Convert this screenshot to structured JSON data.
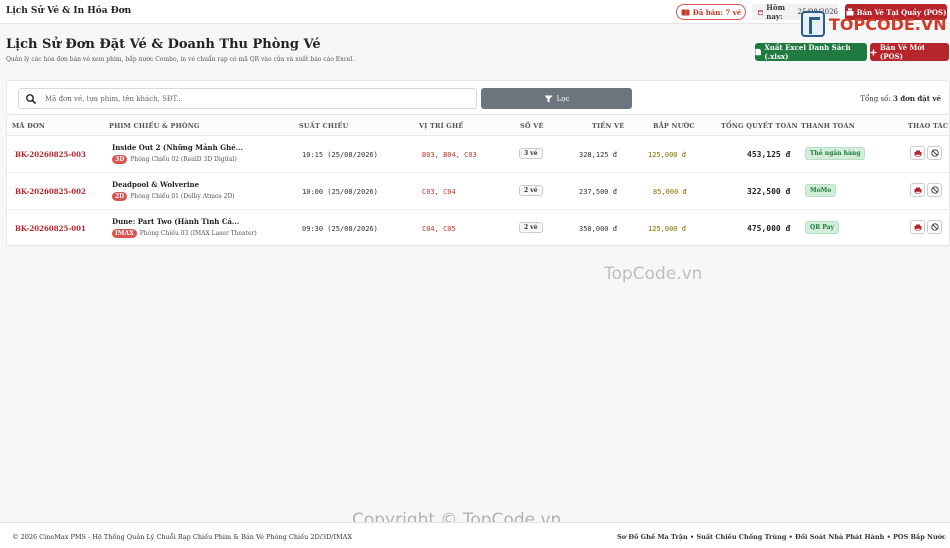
{
  "header": {
    "app_title": "Lịch Sử Vé & In Hóa Đơn",
    "sold_label": "Đã bán: 7 vé",
    "today_label": "Hôm nay:",
    "today_value": "25/08/2026",
    "pos_button": "Bán Vé Tại Quầy (POS)"
  },
  "logo": {
    "text": "TOPCODE.VN"
  },
  "page": {
    "title": "Lịch Sử Đơn Đặt Vé & Doanh Thu Phòng Vé",
    "subtitle": "Quản lý các hóa đơn bán vé xem phim, bắp nước Combo, in vé chuẩn rạp có mã QR vào cửa và xuất báo cáo Excel.",
    "export_button": "Xuất Excel Danh Sách (.xlsx)",
    "new_button": "Bán Vé Mới (POS)"
  },
  "filters": {
    "search_placeholder": "Mã đơn vé, tựa phim, tên khách, SĐT...",
    "filter_button": "Lọc",
    "total_prefix": "Tổng số:",
    "total_value": "3 đơn đặt vé"
  },
  "table": {
    "headers": [
      "MÃ ĐƠN",
      "PHIM CHIẾU & PHÒNG",
      "SUẤT CHIẾU",
      "VỊ TRÍ GHẾ",
      "SỐ VÉ",
      "TIỀN VÉ",
      "BẮP NƯỚC",
      "TỔNG QUYẾT TOÁN",
      "THANH TOÁN",
      "THAO TÁC"
    ],
    "rows": [
      {
        "code": "BK-20260825-003",
        "movie": "Inside Out 2 (Những Mảnh Ghé...",
        "format": "3D",
        "room": "Phòng Chiếu 02 (RealD 3D Digital)",
        "showtime": "10:15 (25/08/2026)",
        "seats": "B03, B04, C03",
        "qty": "3 vé",
        "ticket": "328,125 đ",
        "snack": "125,000 đ",
        "grand": "453,125 đ",
        "payment": "Thẻ ngân hàng"
      },
      {
        "code": "BK-20260825-002",
        "movie": "Deadpool & Wolverine",
        "format": "2D",
        "room": "Phòng Chiếu 01 (Dolby Atmos 2D)",
        "showtime": "10:00 (25/08/2026)",
        "seats": "C03, C04",
        "qty": "2 vé",
        "ticket": "237,500 đ",
        "snack": "85,000 đ",
        "grand": "322,500 đ",
        "payment": "MoMo"
      },
      {
        "code": "BK-20260825-001",
        "movie": "Dune: Part Two (Hành Tinh Cá...",
        "format": "IMAX",
        "room": "Phòng Chiếu 03 (IMAX Laser Theater)",
        "showtime": "09:30 (25/08/2026)",
        "seats": "C04, C05",
        "qty": "2 vé",
        "ticket": "350,000 đ",
        "snack": "125,000 đ",
        "grand": "475,000 đ",
        "payment": "QR Pay"
      }
    ]
  },
  "footer": {
    "left": "© 2026 CineMax PMS - Hệ Thống Quản Lý Chuỗi Rạp Chiếu Phim & Bán Vé Phòng Chiếu 2D/3D/IMAX",
    "right": "Sơ Đồ Ghế Ma Trận • Suất Chiếu Chống Trùng • Đối Soát Nhà Phát Hành • POS Bắp Nước"
  },
  "watermarks": {
    "middle": "TopCode.vn",
    "bottom": "Copyright © TopCode.vn"
  },
  "colors": {
    "primary_red": "#b5252a",
    "excel_green": "#1e7a3e",
    "filter_gray": "#6c757d",
    "payment_green": "#d4edda"
  },
  "icons": [
    "ticket-icon",
    "calendar-icon",
    "cash-register-icon",
    "file-excel-icon",
    "plus-icon",
    "search-icon",
    "filter-icon",
    "print-icon",
    "cancel-icon"
  ]
}
